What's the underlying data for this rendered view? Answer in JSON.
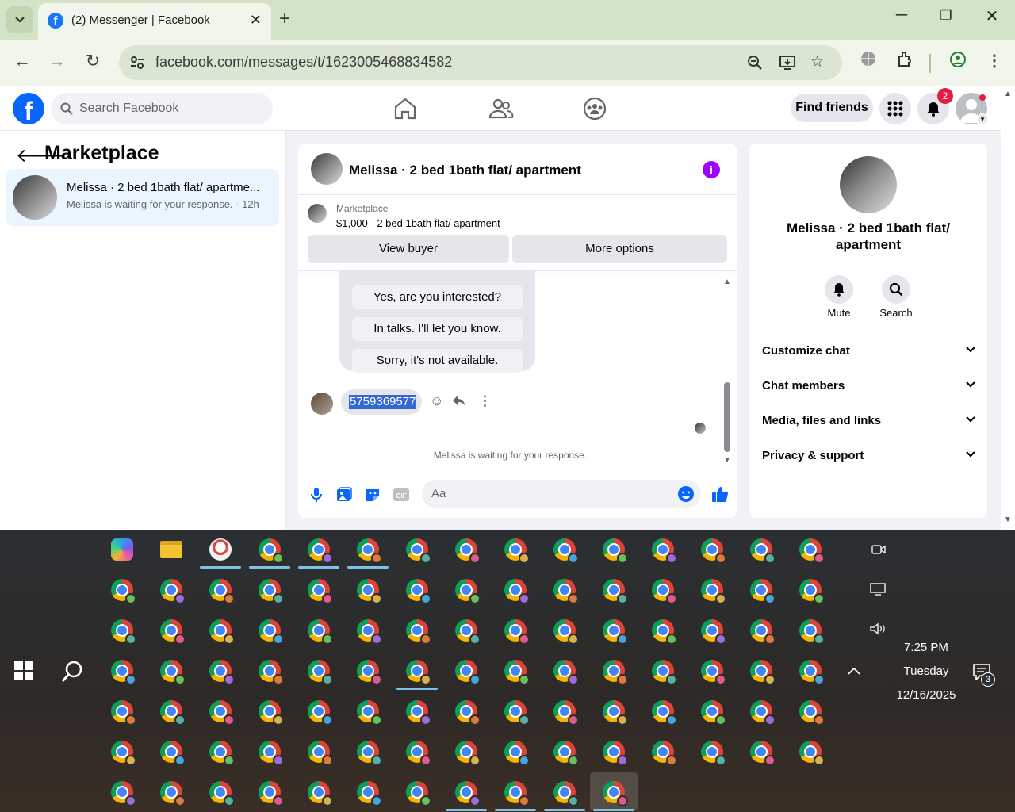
{
  "browser": {
    "tab_title": "(2) Messenger | Facebook",
    "new_tab": "+",
    "url": "facebook.com/messages/t/1623005468834582",
    "win_min": "─",
    "win_max": "❐",
    "win_close": "✕"
  },
  "fb_header": {
    "search_placeholder": "Search Facebook",
    "find_friends": "Find friends",
    "notif_count": "2"
  },
  "sidebar": {
    "title": "Marketplace",
    "conversation": {
      "name": "Melissa · 2 bed 1bath flat/ apartme...",
      "subtitle": "Melissa is waiting for your response. · 12h"
    }
  },
  "chat": {
    "header_name": "Melissa · 2 bed 1bath flat/ apartment",
    "marketplace_label": "Marketplace",
    "listing": "$1,000 - 2 bed 1bath flat/ apartment",
    "view_buyer": "View buyer",
    "more_options": "More options",
    "quick_replies": [
      "Yes, are you interested?",
      "In talks. I'll let you know.",
      "Sorry, it's not available."
    ],
    "message": "5759369577",
    "waiting": "Melissa is waiting for your response.",
    "composer_placeholder": "Aa"
  },
  "info_panel": {
    "name": "Melissa · 2 bed 1bath flat/ apartment",
    "mute": "Mute",
    "search": "Search",
    "rows": [
      "Customize chat",
      "Chat members",
      "Media, files and links",
      "Privacy & support"
    ]
  },
  "taskbar": {
    "time": "7:25 PM",
    "day": "Tuesday",
    "date": "12/16/2025",
    "notification_count": "3"
  },
  "colors": {
    "fb_blue": "#0866ff",
    "selection": "#3367d6",
    "info_purple": "#a000ff"
  }
}
